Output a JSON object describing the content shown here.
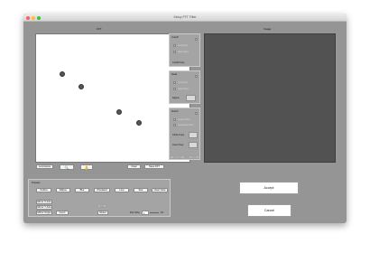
{
  "window": {
    "title": "Setup FFT Filter",
    "fft_label": "FFT",
    "image_label": "Image",
    "traffic_colors": [
      "#fd5f57",
      "#febc2e",
      "#28c840"
    ]
  },
  "left_controls": {
    "zoom_select": "Luminance",
    "clear_label": "Clear",
    "save_fft_label": "Save FFT"
  },
  "cutoff": {
    "title": "Cutoff",
    "options": [
      "Low Pass",
      "High Pass"
    ],
    "freq_label": "Cutoff Freq:"
  },
  "ideal": {
    "title": "Ideal",
    "options": [
      "Low Pass",
      "High Pass"
    ],
    "sigma_label": "Sigma:"
  },
  "notch": {
    "title": "Notch",
    "options": [
      "Linear Pass",
      "Gaussian Pass"
    ],
    "circle_freq_label": "Circle Freq:",
    "inner_freq_label": "Inner Freq:",
    "preview_label": "Preview",
    "undo_label": "Undo"
  },
  "presets": {
    "title": "Presets",
    "row1": [
      "Outline",
      "Ellipse",
      "Blur",
      "Pixelated",
      "Line",
      "Star",
      "Clear View"
    ],
    "mirror_x": "Mirror X Axis",
    "mirror_y": "Mirror Y Axis",
    "mirror_origin": "Mirror Origin",
    "invert": "Invert",
    "sep": "Sep",
    "reset": "Reset",
    "pen_size_label": "Pen Size:",
    "pen_size_value": "1",
    "pen_size_end": "10"
  },
  "actions": {
    "accept_label": "Accept",
    "cancel_label": "Cancel"
  }
}
